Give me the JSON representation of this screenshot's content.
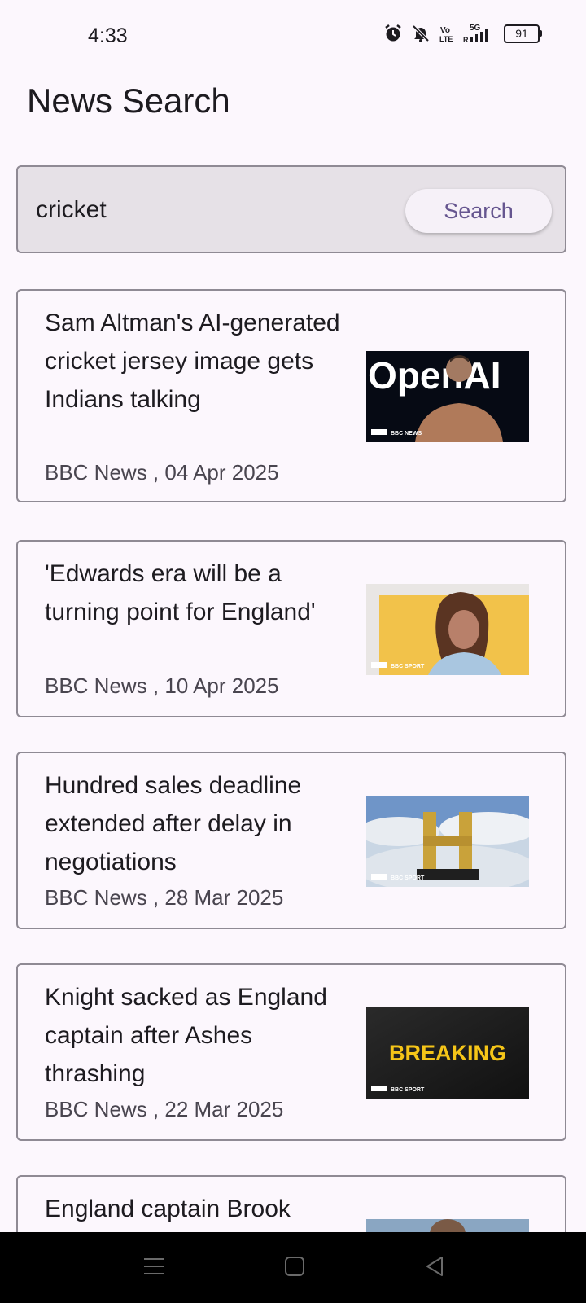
{
  "status": {
    "time": "4:33",
    "battery": "91",
    "network": "5G"
  },
  "page": {
    "title": "News Search"
  },
  "search": {
    "value": "cricket",
    "button_label": "Search"
  },
  "results": [
    {
      "title": "Sam Altman's AI-generated cricket jersey image gets Indians talking",
      "meta": "BBC News , 04 Apr 2025",
      "thumb_text": "OpenAI",
      "thumb_badge": "BBC NEWS"
    },
    {
      "title": "'Edwards era will be a turning point for England'",
      "meta": "BBC News , 10 Apr 2025",
      "thumb_badge": "BBC SPORT"
    },
    {
      "title": "Hundred sales deadline extended after delay in negotiations",
      "meta": "BBC News , 28 Mar 2025",
      "thumb_badge": "BBC SPORT"
    },
    {
      "title": "Knight sacked as England captain after Ashes thrashing",
      "meta": "BBC News , 22 Mar 2025",
      "thumb_text": "BREAKING",
      "thumb_badge": "BBC SPORT"
    },
    {
      "title": "England captain Brook"
    }
  ],
  "icons": {
    "alarm": "alarm-icon",
    "mute": "bell-off-icon",
    "volte": "volte-icon",
    "signal": "signal-icon",
    "menu": "menu-icon",
    "home": "home-icon",
    "back": "back-icon"
  },
  "colors": {
    "accent": "#65558f",
    "background": "#fcf7fd",
    "border": "#8f8a94"
  }
}
